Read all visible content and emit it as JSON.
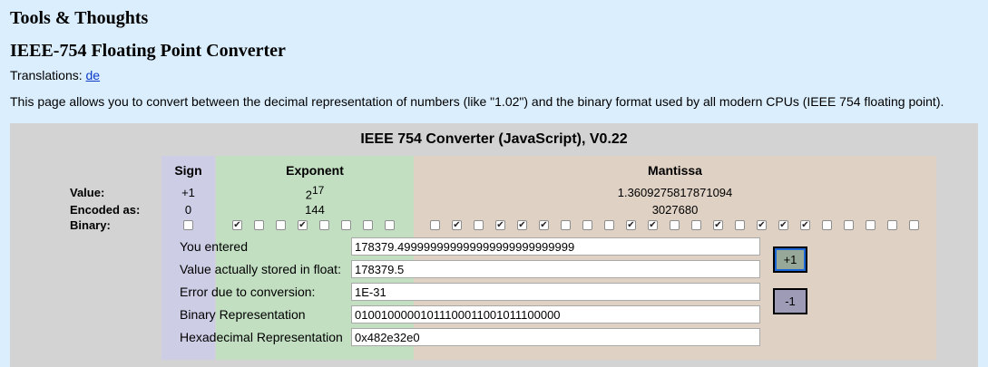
{
  "header": {
    "site_title": "Tools & Thoughts",
    "page_title": "IEEE-754 Floating Point Converter",
    "translations_label": "Translations: ",
    "translations_link": "de",
    "intro": "This page allows you to convert between the decimal representation of numbers (like \"1.02\") and the binary format used by all modern CPUs (IEEE 754 floating point)."
  },
  "converter": {
    "title": "IEEE 754 Converter (JavaScript), V0.22",
    "columns": {
      "sign": "Sign",
      "exponent": "Exponent",
      "mantissa": "Mantissa"
    },
    "row_labels": {
      "value": "Value:",
      "encoded": "Encoded as:",
      "binary": "Binary:"
    },
    "sign": {
      "value": "+1",
      "encoded": "0"
    },
    "exponent": {
      "value_base": "2",
      "value_power": "17",
      "encoded": "144"
    },
    "mantissa": {
      "value": "1.3609275817871094",
      "encoded": "3027680"
    },
    "bits": [
      0,
      1,
      0,
      0,
      1,
      0,
      0,
      0,
      0,
      0,
      1,
      0,
      1,
      1,
      1,
      0,
      0,
      0,
      1,
      1,
      0,
      0,
      1,
      0,
      1,
      1,
      1,
      0,
      0,
      0,
      0,
      0
    ]
  },
  "fields": {
    "you_entered": {
      "label": "You entered",
      "value": "178379.499999999999999999999999999"
    },
    "stored": {
      "label": "Value actually stored in float:",
      "value": "178379.5"
    },
    "error": {
      "label": "Error due to conversion:",
      "value": "1E-31"
    },
    "binary": {
      "label": "Binary Representation",
      "value": "01001000001011100011001011100000"
    },
    "hex": {
      "label": "Hexadecimal Representation",
      "value": "0x482e32e0"
    }
  },
  "buttons": {
    "plus": "+1",
    "minus": "-1"
  },
  "colors": {
    "background": "#dbeefd",
    "panel": "#d3d3d3",
    "sign": "#cdcde6",
    "exponent": "#c2dfc2",
    "mantissa": "#dfd1c4"
  }
}
